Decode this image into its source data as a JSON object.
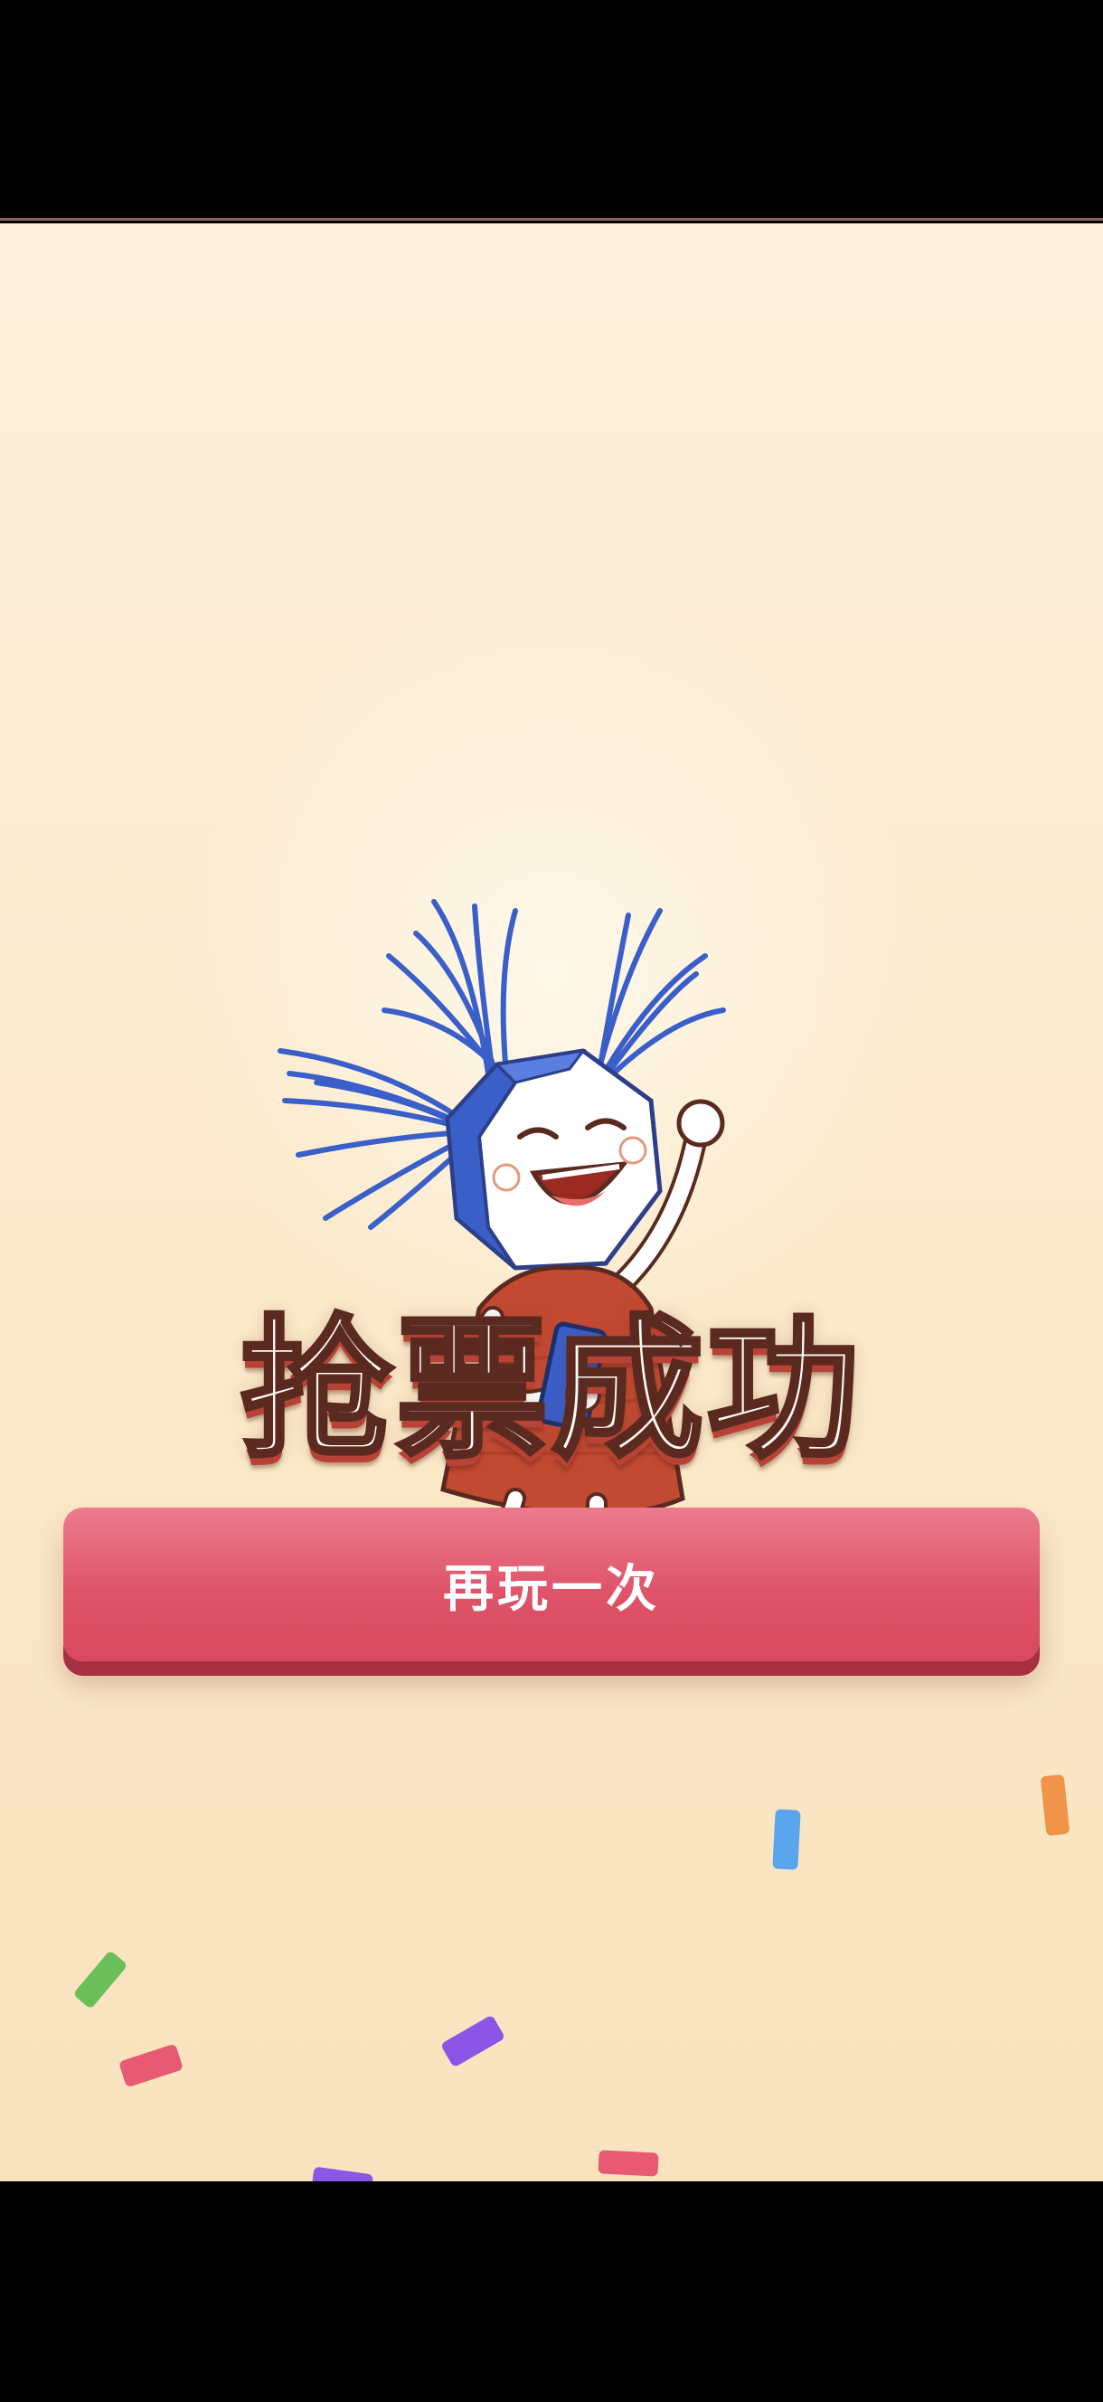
{
  "result": {
    "title": "抢票成功",
    "replay_label": "再玩一次"
  },
  "colors": {
    "background": "#fbecd0",
    "button": "#de5469",
    "button_shadow": "#a62f42",
    "title_fill": "#fffaf2",
    "title_shadow": "#b84235"
  },
  "mascot": {
    "icon": "celebrating-girl-with-phone-illustration"
  },
  "confetti_colors": [
    "#6bbf5a",
    "#e85a74",
    "#8b55e6",
    "#5aa6ee",
    "#f0944a",
    "#e85a74",
    "#8b55e6"
  ]
}
